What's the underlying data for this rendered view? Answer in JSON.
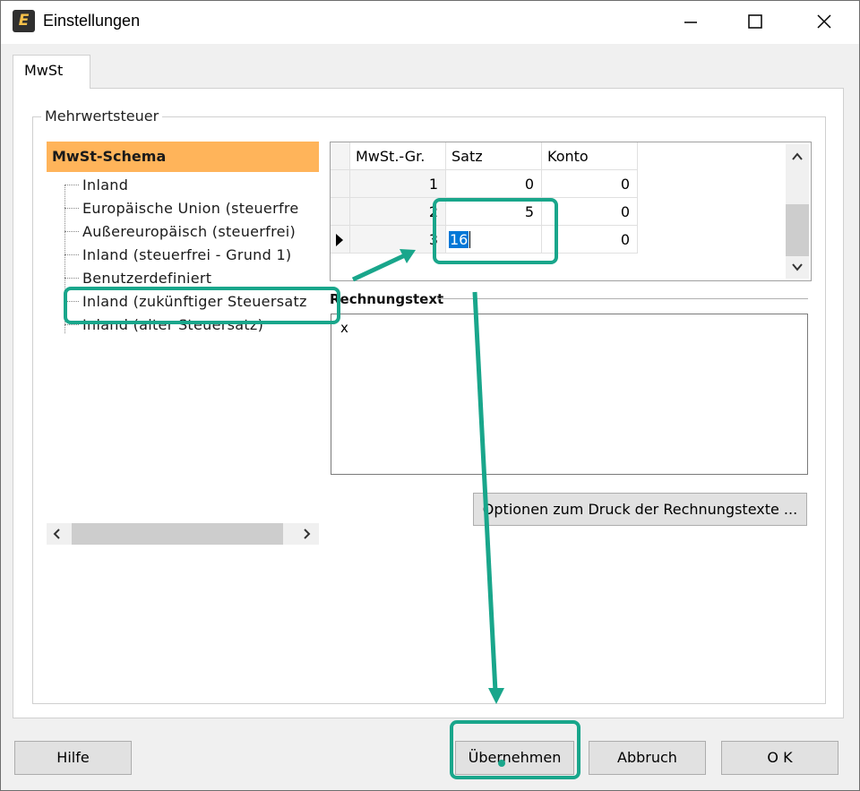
{
  "window": {
    "title": "Einstellungen",
    "app_icon": "E",
    "controls": [
      "minimize-icon",
      "maximize-icon",
      "close-icon"
    ]
  },
  "tabs": [
    {
      "label": "MwSt",
      "selected": true
    }
  ],
  "group": {
    "caption": "Mehrwertsteuer"
  },
  "tree": {
    "header": "MwSt-Schema",
    "items": [
      "Inland",
      "Europäische Union (steuerfre",
      "Außereuropäisch (steuerfrei)",
      "Inland (steuerfrei - Grund 1)",
      "Benutzerdefiniert",
      "Inland (zukünftiger Steuersatz",
      "Inland (alter Steuersatz)"
    ],
    "selected_index": 5
  },
  "grid": {
    "columns": [
      "MwSt.-Gr.",
      "Satz",
      "Konto"
    ],
    "rows": [
      {
        "group": "1",
        "rate": "0",
        "account": "0"
      },
      {
        "group": "2",
        "rate": "5",
        "account": "0"
      },
      {
        "group": "3",
        "rate": "16",
        "account": "0",
        "current": true,
        "editing": true
      }
    ]
  },
  "rechnungstext": {
    "label": "Rechnungstext",
    "value": "x"
  },
  "buttons": {
    "options": "Optionen zum Druck der Rechnungstexte ...",
    "hilfe": "Hilfe",
    "uebernehmen": "Übernehmen",
    "abbruch": "Abbruch",
    "ok": "O K"
  },
  "colors": {
    "tree_header": "#ffb45a",
    "callout": "#19a68b",
    "selection": "#0078d7"
  }
}
